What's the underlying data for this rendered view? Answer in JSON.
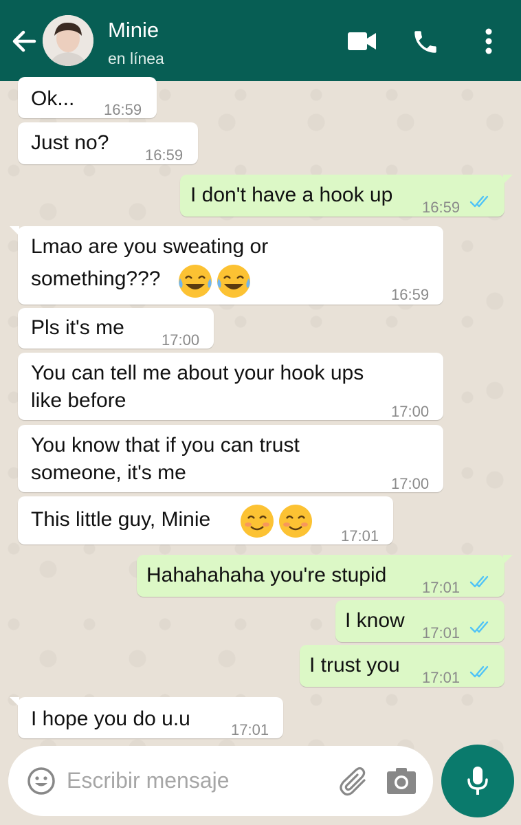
{
  "header": {
    "contact_name": "Minie",
    "status": "en línea",
    "background": "#075e54",
    "icons": [
      "back-arrow-icon",
      "video-camera-icon",
      "phone-icon",
      "more-options-icon"
    ]
  },
  "messages": [
    {
      "dir": "in",
      "text": "Ok...",
      "time": "16:59"
    },
    {
      "dir": "in",
      "text": "Just no?",
      "time": "16:59"
    },
    {
      "dir": "out",
      "text": "I don't have a hook up",
      "time": "16:59",
      "read": true
    },
    {
      "dir": "in",
      "line1": "Lmao are you sweating or",
      "line2": "something???",
      "emoji": "😂😂",
      "time": "16:59"
    },
    {
      "dir": "in",
      "text": "Pls it's me",
      "time": "17:00"
    },
    {
      "dir": "in",
      "line1": "You can tell me about your hook ups",
      "line2": "like before",
      "time": "17:00"
    },
    {
      "dir": "in",
      "line1": "You know that if you can trust",
      "line2": "someone, it's me",
      "time": "17:00"
    },
    {
      "dir": "in",
      "text": "This little guy, Minie",
      "emoji": "😊😊",
      "time": "17:01"
    },
    {
      "dir": "out",
      "text": "Hahahahaha you're stupid",
      "time": "17:01",
      "read": true
    },
    {
      "dir": "out",
      "text": "I know",
      "time": "17:01",
      "read": true
    },
    {
      "dir": "out",
      "text": "I trust you",
      "time": "17:01",
      "read": true
    },
    {
      "dir": "in",
      "text": "I hope you do u.u",
      "time": "17:01"
    }
  ],
  "composer": {
    "placeholder": "Escribir mensaje",
    "icons": [
      "emoji-icon",
      "attach-icon",
      "camera-icon",
      "microphone-icon"
    ]
  },
  "colors": {
    "outgoing_bubble": "#dcf8c6",
    "incoming_bubble": "#ffffff",
    "read_tick": "#4fc3f7",
    "accent": "#075e54"
  }
}
